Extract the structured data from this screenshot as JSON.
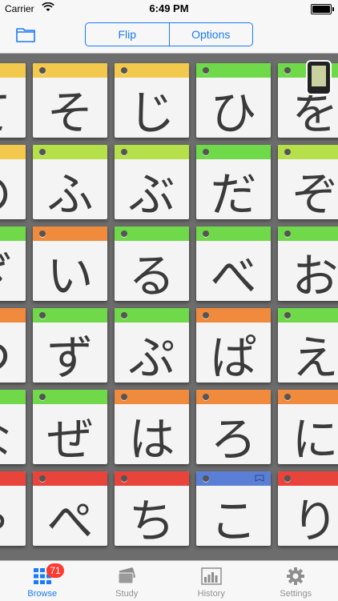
{
  "status": {
    "carrier": "Carrier",
    "time": "6:49 PM"
  },
  "nav": {
    "segments": [
      "Flip",
      "Options"
    ]
  },
  "colors": {
    "yellow": "#f2c94c",
    "lime": "#b5e04a",
    "green": "#6fd94a",
    "orange": "#f08a3c",
    "red": "#e8443c",
    "blue": "#5b7fd6"
  },
  "grid": {
    "rows": [
      {
        "cells": [
          {
            "kana": "て",
            "color": "yellow"
          },
          {
            "kana": "そ",
            "color": "yellow"
          },
          {
            "kana": "じ",
            "color": "yellow"
          },
          {
            "kana": "ひ",
            "color": "green"
          },
          {
            "kana": "を",
            "color": "green"
          }
        ]
      },
      {
        "cells": [
          {
            "kana": "の",
            "color": "yellow"
          },
          {
            "kana": "ふ",
            "color": "lime"
          },
          {
            "kana": "ぶ",
            "color": "lime"
          },
          {
            "kana": "だ",
            "color": "green"
          },
          {
            "kana": "ぞ",
            "color": "lime"
          }
        ]
      },
      {
        "cells": [
          {
            "kana": "ざ",
            "color": "green"
          },
          {
            "kana": "い",
            "color": "orange"
          },
          {
            "kana": "る",
            "color": "green"
          },
          {
            "kana": "べ",
            "color": "green"
          },
          {
            "kana": "お",
            "color": "green"
          }
        ]
      },
      {
        "cells": [
          {
            "kana": "つ",
            "color": "orange"
          },
          {
            "kana": "ず",
            "color": "green"
          },
          {
            "kana": "ぷ",
            "color": "green"
          },
          {
            "kana": "ぱ",
            "color": "orange"
          },
          {
            "kana": "え",
            "color": "green"
          }
        ]
      },
      {
        "cells": [
          {
            "kana": "な",
            "color": "green"
          },
          {
            "kana": "ぜ",
            "color": "green"
          },
          {
            "kana": "は",
            "color": "orange"
          },
          {
            "kana": "ろ",
            "color": "orange"
          },
          {
            "kana": "に",
            "color": "orange"
          }
        ]
      },
      {
        "cells": [
          {
            "kana": "ゃ",
            "color": "red"
          },
          {
            "kana": "ぺ",
            "color": "red"
          },
          {
            "kana": "ち",
            "color": "red"
          },
          {
            "kana": "こ",
            "color": "blue"
          },
          {
            "kana": "り",
            "color": "red"
          }
        ]
      }
    ]
  },
  "tabs": [
    {
      "label": "Browse",
      "icon": "grid-icon",
      "badge": "71",
      "active": true
    },
    {
      "label": "Study",
      "icon": "cards-icon"
    },
    {
      "label": "History",
      "icon": "bar-chart-icon"
    },
    {
      "label": "Settings",
      "icon": "gear-icon"
    }
  ]
}
